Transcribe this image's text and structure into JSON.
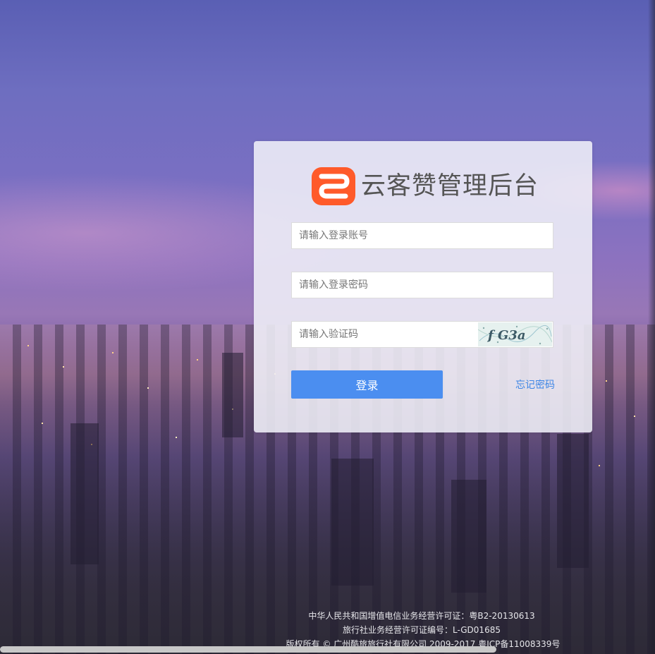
{
  "brand": {
    "title": "云客赞管理后台",
    "logo_icon": "logo-icon",
    "logo_colors": [
      "#ff6a2b",
      "#ff3d1f"
    ]
  },
  "form": {
    "account_placeholder": "请输入登录账号",
    "password_placeholder": "请输入登录密码",
    "captcha_placeholder": "请输入验证码",
    "captcha_text": "f G3a",
    "login_label": "登录",
    "forgot_label": "忘记密码"
  },
  "footer": {
    "license": "中华人民共和国增值电信业务经营许可证：粤B2-20130613",
    "travel_license": "旅行社业务经营许可证编号：L-GD01685",
    "copyright": "版权所有 © 广州酷旅旅行社有限公司 2009-2017 粤ICP备11008339号"
  },
  "colors": {
    "primary_button": "#4b8ef0",
    "link": "#3d86e6"
  }
}
